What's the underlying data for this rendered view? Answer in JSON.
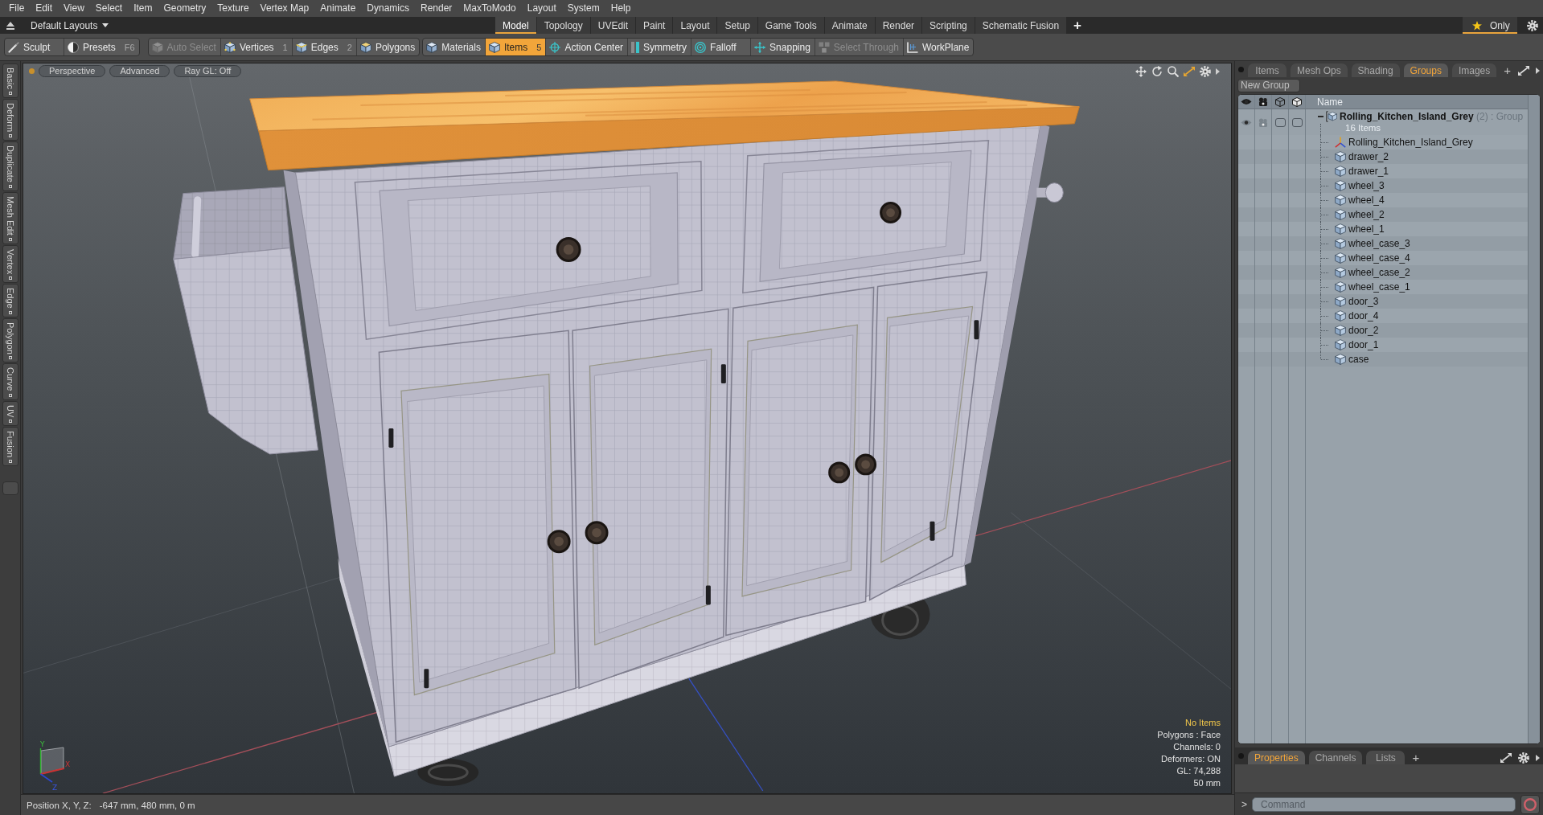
{
  "menu_bar": [
    "File",
    "Edit",
    "View",
    "Select",
    "Item",
    "Geometry",
    "Texture",
    "Vertex Map",
    "Animate",
    "Dynamics",
    "Render",
    "MaxToModo",
    "Layout",
    "System",
    "Help"
  ],
  "layout_bar": {
    "preset": "Default Layouts",
    "tabs": [
      {
        "label": "Model",
        "selected": true
      },
      {
        "label": "Topology",
        "selected": false
      },
      {
        "label": "UVEdit",
        "selected": false
      },
      {
        "label": "Paint",
        "selected": false
      },
      {
        "label": "Layout",
        "selected": false
      },
      {
        "label": "Setup",
        "selected": false
      },
      {
        "label": "Game Tools",
        "selected": false
      },
      {
        "label": "Animate",
        "selected": false
      },
      {
        "label": "Render",
        "selected": false
      },
      {
        "label": "Scripting",
        "selected": false
      },
      {
        "label": "Schematic Fusion",
        "selected": false
      }
    ],
    "add": "+",
    "only": {
      "label": "Only",
      "on": true
    }
  },
  "toolbar": [
    {
      "items": [
        {
          "label": "Sculpt",
          "kind": "brush",
          "selected": false,
          "disabled": false
        },
        {
          "label": "Presets",
          "kind": "presets",
          "shortcut": "F6",
          "selected": false,
          "disabled": false
        }
      ]
    },
    {
      "items": [
        {
          "label": "Auto Select",
          "kind": "cube",
          "selected": false,
          "disabled": true
        },
        {
          "label": "Vertices",
          "kind": "vertex",
          "shortcut": "1",
          "selected": false,
          "disabled": false
        },
        {
          "label": "Edges",
          "kind": "edge",
          "shortcut": "2",
          "selected": false,
          "disabled": false
        },
        {
          "label": "Polygons",
          "kind": "polygon",
          "selected": false,
          "disabled": false
        }
      ]
    },
    {
      "items": [
        {
          "label": "Materials",
          "kind": "material",
          "selected": false,
          "disabled": false
        },
        {
          "label": "Items",
          "kind": "item",
          "shortcut": "5",
          "selected": true,
          "disabled": false
        },
        {
          "label": "Action Center",
          "kind": "crosshair",
          "selected": false,
          "disabled": false
        },
        {
          "label": "Symmetry",
          "kind": "symmetry",
          "selected": false,
          "disabled": false
        },
        {
          "label": "Falloff",
          "kind": "falloff",
          "selected": false,
          "disabled": false
        },
        {
          "label": "Snapping",
          "kind": "snap",
          "selected": false,
          "disabled": false
        },
        {
          "label": "Select Through",
          "kind": "select_through",
          "selected": false,
          "disabled": true
        },
        {
          "label": "WorkPlane",
          "kind": "workplane",
          "selected": false,
          "disabled": false
        }
      ]
    }
  ],
  "side_tabs": [
    {
      "label": "Basic",
      "selected": false
    },
    {
      "label": "Deform",
      "selected": false
    },
    {
      "label": "Duplicate",
      "selected": false
    },
    {
      "label": "Mesh Edit",
      "selected": false
    },
    {
      "label": "Vertex",
      "selected": false
    },
    {
      "label": "Edge",
      "selected": false
    },
    {
      "label": "Polygon",
      "selected": false
    },
    {
      "label": "Curve",
      "selected": false
    },
    {
      "label": "UV",
      "selected": false
    },
    {
      "label": "Fusion",
      "selected": false
    }
  ],
  "viewport": {
    "buttons": [
      "Perspective",
      "Advanced",
      "Ray GL: Off"
    ],
    "axis_labels": [
      "Y",
      "X",
      "Z"
    ],
    "info": [
      {
        "text": "No Items",
        "highlight": true
      },
      {
        "text": "Polygons : Face",
        "highlight": false
      },
      {
        "text": "Channels: 0",
        "highlight": false
      },
      {
        "text": "Deformers: ON",
        "highlight": false
      },
      {
        "text": "GL: 74,288",
        "highlight": false
      },
      {
        "text": "50 mm",
        "highlight": false
      }
    ]
  },
  "status_bar": {
    "label": "Position X, Y, Z:",
    "value": "-647 mm, 480 mm, 0 m"
  },
  "panel": {
    "tabs": [
      {
        "label": "Items",
        "selected": false
      },
      {
        "label": "Mesh Ops",
        "selected": false
      },
      {
        "label": "Shading",
        "selected": false
      },
      {
        "label": "Groups",
        "selected": true
      },
      {
        "label": "Images",
        "selected": false
      }
    ],
    "add": "+",
    "new_group": "New Group",
    "tree": {
      "name_column": "Name",
      "group": {
        "name": "Rolling_Kitchen_Island_Grey",
        "count": "(2)",
        "type": ": Group",
        "subtitle": "16 Items",
        "visible": true,
        "render": true,
        "expanded": true,
        "children": [
          {
            "name": "Rolling_Kitchen_Island_Grey",
            "kind": "locator"
          },
          {
            "name": "drawer_2",
            "kind": "mesh"
          },
          {
            "name": "drawer_1",
            "kind": "mesh"
          },
          {
            "name": "wheel_3",
            "kind": "mesh"
          },
          {
            "name": "wheel_4",
            "kind": "mesh"
          },
          {
            "name": "wheel_2",
            "kind": "mesh"
          },
          {
            "name": "wheel_1",
            "kind": "mesh"
          },
          {
            "name": "wheel_case_3",
            "kind": "mesh"
          },
          {
            "name": "wheel_case_4",
            "kind": "mesh"
          },
          {
            "name": "wheel_case_2",
            "kind": "mesh"
          },
          {
            "name": "wheel_case_1",
            "kind": "mesh"
          },
          {
            "name": "door_3",
            "kind": "mesh"
          },
          {
            "name": "door_4",
            "kind": "mesh"
          },
          {
            "name": "door_2",
            "kind": "mesh"
          },
          {
            "name": "door_1",
            "kind": "mesh"
          },
          {
            "name": "case",
            "kind": "mesh"
          }
        ]
      }
    }
  },
  "bottom_panel": {
    "tabs": [
      {
        "label": "Properties",
        "selected": true
      },
      {
        "label": "Channels",
        "selected": false
      },
      {
        "label": "Lists",
        "selected": false
      }
    ],
    "add": "+"
  },
  "command": {
    "prompt": ">",
    "placeholder": "Command"
  }
}
